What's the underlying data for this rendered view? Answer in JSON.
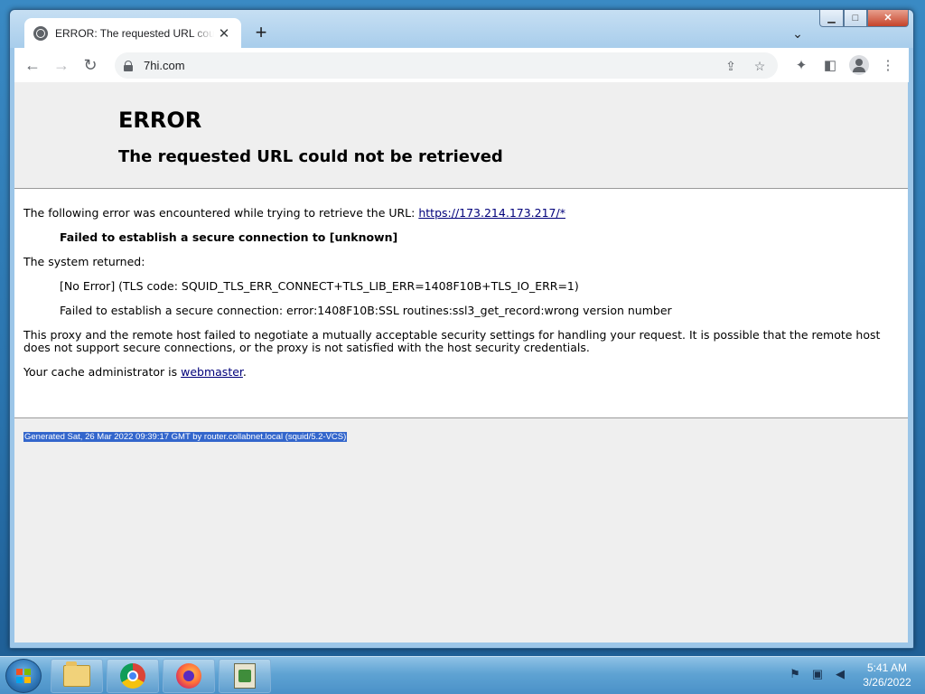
{
  "browser": {
    "tab_title": "ERROR: The requested URL could not be retrieved",
    "new_tab_label": "+",
    "url": "7hi.com"
  },
  "page": {
    "heading": "ERROR",
    "subheading": "The requested URL could not be retrieved",
    "intro": "The following error was encountered while trying to retrieve the URL: ",
    "intro_link": "https://173.214.173.217/*",
    "failure": "Failed to establish a secure connection to [unknown]",
    "system_returned": "The system returned:",
    "tls_code": "[No Error] (TLS code: SQUID_TLS_ERR_CONNECT+TLS_LIB_ERR=1408F10B+TLS_IO_ERR=1)",
    "ssl_error": "Failed to establish a secure connection: error:1408F10B:SSL routines:ssl3_get_record:wrong version number",
    "explanation": "This proxy and the remote host failed to negotiate a mutually acceptable security settings for handling your request. It is possible that the remote host does not support secure connections, or the proxy is not satisfied with the host security credentials.",
    "admin_prefix": "Your cache administrator is ",
    "admin_link": "webmaster",
    "admin_suffix": ".",
    "footer": "Generated Sat, 26 Mar 2022 09:39:17 GMT by router.collabnet.local (squid/5.2-VCS)"
  },
  "taskbar": {
    "time": "5:41 AM",
    "date": "3/26/2022",
    "apps": [
      "folder-icon",
      "chrome-icon",
      "firefox-icon",
      "app-icon"
    ]
  },
  "colors": {
    "link": "#00007a",
    "selection": "#3366cc",
    "page_header_bg": "#efefef"
  }
}
